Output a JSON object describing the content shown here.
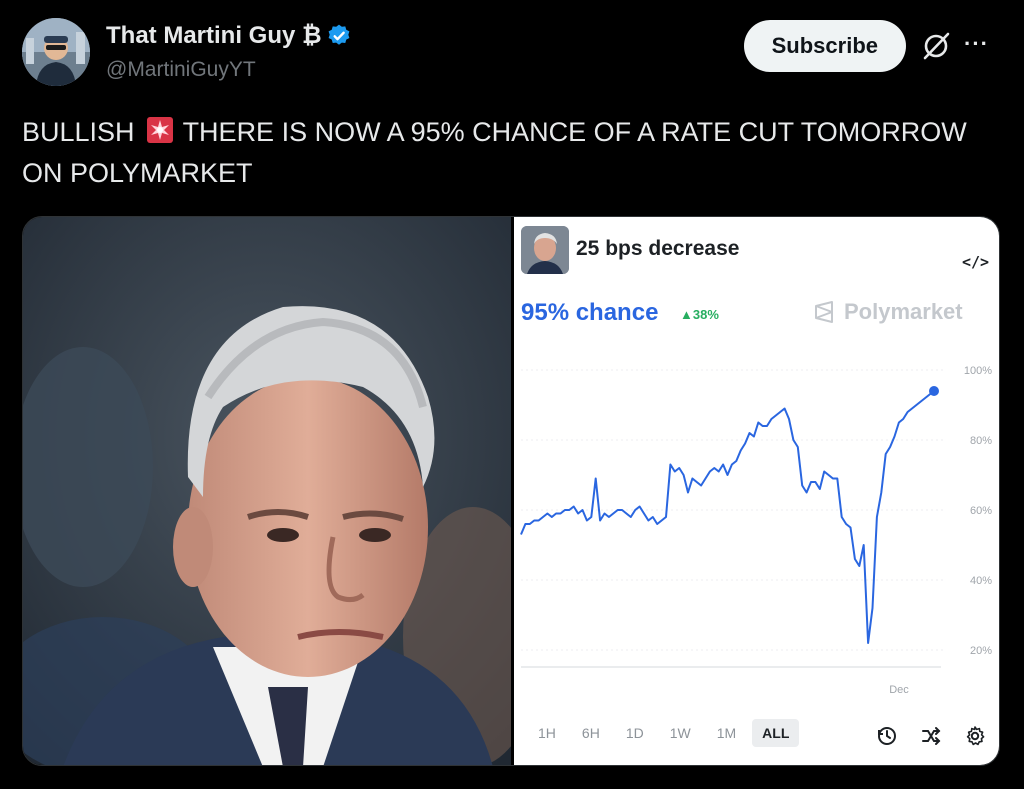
{
  "author": {
    "display_name": "That Martini Guy ₿",
    "handle": "@MartiniGuyYT"
  },
  "actions": {
    "subscribe_label": "Subscribe",
    "more_label": "···"
  },
  "tweet": {
    "text_part1": "BULLISH",
    "text_part2": "THERE IS NOW A 95% CHANCE OF A RATE CUT TOMORROW ON POLYMARKET"
  },
  "market_card": {
    "title": "25 bps decrease",
    "embed_label": "</>",
    "chance_label": "95% chance",
    "change_label": "▲38%",
    "brand": "Polymarket",
    "x_tick": "Dec",
    "timeframes": [
      "1H",
      "6H",
      "1D",
      "1W",
      "1M",
      "ALL"
    ],
    "active_timeframe": "ALL",
    "accent_color": "#2a66e0",
    "positive_color": "#27ae60"
  },
  "chart_data": {
    "type": "line",
    "y_ticks": [
      "100%",
      "80%",
      "60%",
      "40%",
      "20%"
    ],
    "ylim": [
      20,
      100
    ],
    "x_tick_labels": [
      "Dec"
    ],
    "grid": true,
    "series": [
      {
        "values": [
          53,
          56,
          56,
          57,
          57,
          58,
          59,
          58,
          59,
          59,
          60,
          60,
          61,
          59,
          60,
          57,
          58,
          69,
          57,
          59,
          58,
          59,
          60,
          60,
          59,
          58,
          60,
          61,
          59,
          57,
          58,
          56,
          57,
          58,
          73,
          71,
          72,
          70,
          65,
          69,
          68,
          67,
          69,
          71,
          72,
          71,
          73,
          70,
          73,
          74,
          77,
          79,
          82,
          81,
          85,
          84,
          84,
          86,
          87,
          88,
          89,
          86,
          80,
          78,
          67,
          65,
          68,
          68,
          66,
          71,
          70,
          69,
          69,
          58,
          56,
          55,
          46,
          44,
          50,
          22,
          32,
          58,
          65,
          76,
          78,
          81,
          85,
          86,
          88,
          89,
          90,
          91,
          92,
          93,
          94
        ]
      }
    ]
  }
}
